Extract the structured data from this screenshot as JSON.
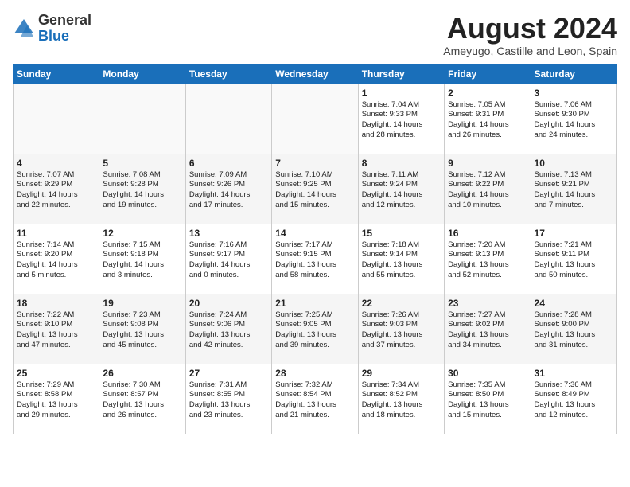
{
  "logo": {
    "general": "General",
    "blue": "Blue"
  },
  "header": {
    "month_year": "August 2024",
    "location": "Ameyugo, Castille and Leon, Spain"
  },
  "days_of_week": [
    "Sunday",
    "Monday",
    "Tuesday",
    "Wednesday",
    "Thursday",
    "Friday",
    "Saturday"
  ],
  "weeks": [
    [
      {
        "day": "",
        "info": ""
      },
      {
        "day": "",
        "info": ""
      },
      {
        "day": "",
        "info": ""
      },
      {
        "day": "",
        "info": ""
      },
      {
        "day": "1",
        "info": "Sunrise: 7:04 AM\nSunset: 9:33 PM\nDaylight: 14 hours\nand 28 minutes."
      },
      {
        "day": "2",
        "info": "Sunrise: 7:05 AM\nSunset: 9:31 PM\nDaylight: 14 hours\nand 26 minutes."
      },
      {
        "day": "3",
        "info": "Sunrise: 7:06 AM\nSunset: 9:30 PM\nDaylight: 14 hours\nand 24 minutes."
      }
    ],
    [
      {
        "day": "4",
        "info": "Sunrise: 7:07 AM\nSunset: 9:29 PM\nDaylight: 14 hours\nand 22 minutes."
      },
      {
        "day": "5",
        "info": "Sunrise: 7:08 AM\nSunset: 9:28 PM\nDaylight: 14 hours\nand 19 minutes."
      },
      {
        "day": "6",
        "info": "Sunrise: 7:09 AM\nSunset: 9:26 PM\nDaylight: 14 hours\nand 17 minutes."
      },
      {
        "day": "7",
        "info": "Sunrise: 7:10 AM\nSunset: 9:25 PM\nDaylight: 14 hours\nand 15 minutes."
      },
      {
        "day": "8",
        "info": "Sunrise: 7:11 AM\nSunset: 9:24 PM\nDaylight: 14 hours\nand 12 minutes."
      },
      {
        "day": "9",
        "info": "Sunrise: 7:12 AM\nSunset: 9:22 PM\nDaylight: 14 hours\nand 10 minutes."
      },
      {
        "day": "10",
        "info": "Sunrise: 7:13 AM\nSunset: 9:21 PM\nDaylight: 14 hours\nand 7 minutes."
      }
    ],
    [
      {
        "day": "11",
        "info": "Sunrise: 7:14 AM\nSunset: 9:20 PM\nDaylight: 14 hours\nand 5 minutes."
      },
      {
        "day": "12",
        "info": "Sunrise: 7:15 AM\nSunset: 9:18 PM\nDaylight: 14 hours\nand 3 minutes."
      },
      {
        "day": "13",
        "info": "Sunrise: 7:16 AM\nSunset: 9:17 PM\nDaylight: 14 hours\nand 0 minutes."
      },
      {
        "day": "14",
        "info": "Sunrise: 7:17 AM\nSunset: 9:15 PM\nDaylight: 13 hours\nand 58 minutes."
      },
      {
        "day": "15",
        "info": "Sunrise: 7:18 AM\nSunset: 9:14 PM\nDaylight: 13 hours\nand 55 minutes."
      },
      {
        "day": "16",
        "info": "Sunrise: 7:20 AM\nSunset: 9:13 PM\nDaylight: 13 hours\nand 52 minutes."
      },
      {
        "day": "17",
        "info": "Sunrise: 7:21 AM\nSunset: 9:11 PM\nDaylight: 13 hours\nand 50 minutes."
      }
    ],
    [
      {
        "day": "18",
        "info": "Sunrise: 7:22 AM\nSunset: 9:10 PM\nDaylight: 13 hours\nand 47 minutes."
      },
      {
        "day": "19",
        "info": "Sunrise: 7:23 AM\nSunset: 9:08 PM\nDaylight: 13 hours\nand 45 minutes."
      },
      {
        "day": "20",
        "info": "Sunrise: 7:24 AM\nSunset: 9:06 PM\nDaylight: 13 hours\nand 42 minutes."
      },
      {
        "day": "21",
        "info": "Sunrise: 7:25 AM\nSunset: 9:05 PM\nDaylight: 13 hours\nand 39 minutes."
      },
      {
        "day": "22",
        "info": "Sunrise: 7:26 AM\nSunset: 9:03 PM\nDaylight: 13 hours\nand 37 minutes."
      },
      {
        "day": "23",
        "info": "Sunrise: 7:27 AM\nSunset: 9:02 PM\nDaylight: 13 hours\nand 34 minutes."
      },
      {
        "day": "24",
        "info": "Sunrise: 7:28 AM\nSunset: 9:00 PM\nDaylight: 13 hours\nand 31 minutes."
      }
    ],
    [
      {
        "day": "25",
        "info": "Sunrise: 7:29 AM\nSunset: 8:58 PM\nDaylight: 13 hours\nand 29 minutes."
      },
      {
        "day": "26",
        "info": "Sunrise: 7:30 AM\nSunset: 8:57 PM\nDaylight: 13 hours\nand 26 minutes."
      },
      {
        "day": "27",
        "info": "Sunrise: 7:31 AM\nSunset: 8:55 PM\nDaylight: 13 hours\nand 23 minutes."
      },
      {
        "day": "28",
        "info": "Sunrise: 7:32 AM\nSunset: 8:54 PM\nDaylight: 13 hours\nand 21 minutes."
      },
      {
        "day": "29",
        "info": "Sunrise: 7:34 AM\nSunset: 8:52 PM\nDaylight: 13 hours\nand 18 minutes."
      },
      {
        "day": "30",
        "info": "Sunrise: 7:35 AM\nSunset: 8:50 PM\nDaylight: 13 hours\nand 15 minutes."
      },
      {
        "day": "31",
        "info": "Sunrise: 7:36 AM\nSunset: 8:49 PM\nDaylight: 13 hours\nand 12 minutes."
      }
    ]
  ]
}
